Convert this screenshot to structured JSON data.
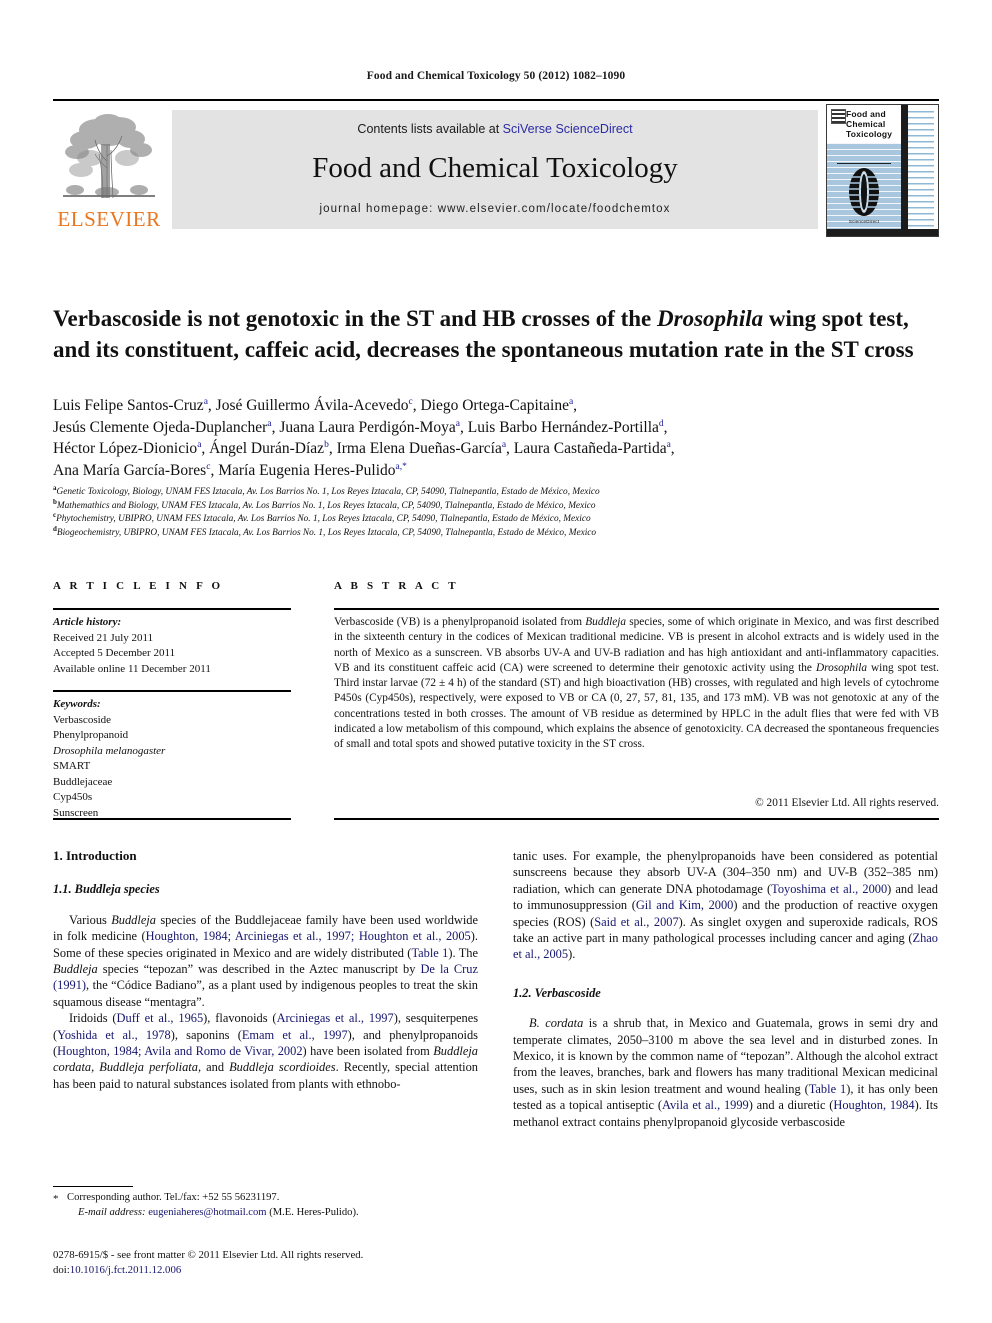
{
  "running_head": "Food and Chemical Toxicology 50 (2012) 1082–1090",
  "masthead": {
    "contents_prefix": "Contents lists available at ",
    "contents_link": "SciVerse ScienceDirect",
    "journal_title": "Food and Chemical Toxicology",
    "homepage": "journal homepage: www.elsevier.com/locate/foodchemtox",
    "publisher_wordmark": "ELSEVIER",
    "publisher_logo_color": "#E87722",
    "link_color": "#2B2BA6"
  },
  "cover": {
    "title_line1": "Food and",
    "title_line2": "Chemical",
    "title_line3": "Toxicology",
    "caption": "ScienceDirect",
    "background_color": "#A8C6DE"
  },
  "article": {
    "title_part1": "Verbascoside is not genotoxic in the ST and HB crosses of the ",
    "title_italic": "Drosophila",
    "title_part2": " wing spot test, and its constituent, caffeic acid, decreases the spontaneous mutation rate in the ST cross",
    "authors_line1": "Luis Felipe Santos-Cruz a, José Guillermo Ávila-Acevedo c, Diego Ortega-Capitaine a,",
    "authors_line2": "Jesús Clemente Ojeda-Duplancher a, Juana Laura Perdigón-Moya a, Luis Barbo Hernández-Portilla d,",
    "authors_line3": "Héctor López-Dionicio a, Ángel Durán-Díaz b, Irma Elena Dueñas-García a, Laura Castañeda-Partida a,",
    "authors_line4": "Ana María García-Bores c, María Eugenia Heres-Pulido a,*",
    "affiliations": [
      {
        "mark": "a",
        "text": "Genetic Toxicology, Biology, UNAM FES Iztacala, Av. Los Barrios No. 1, Los Reyes Iztacala, CP, 54090, Tlalnepantla, Estado de México, Mexico"
      },
      {
        "mark": "b",
        "text": "Mathemathics and Biology, UNAM FES Iztacala, Av. Los Barrios No. 1, Los Reyes Iztacala, CP, 54090, Tlalnepantla, Estado de México, Mexico"
      },
      {
        "mark": "c",
        "text": "Phytochemistry, UBIPRO, UNAM FES Iztacala, Av. Los Barrios No. 1, Los Reyes Iztacala, CP, 54090, Tlalnepantla, Estado de México, Mexico"
      },
      {
        "mark": "d",
        "text": "Biogeochemistry, UBIPRO, UNAM FES Iztacala, Av. Los Barrios No. 1, Los Reyes Iztacala, CP, 54090, Tlalnepantla, Estado de México, Mexico"
      }
    ]
  },
  "article_info": {
    "heading": "A R T I C L E    I N F O",
    "history_label": "Article history:",
    "history": [
      "Received 21 July 2011",
      "Accepted 5 December 2011",
      "Available online 11 December 2011"
    ],
    "keywords_label": "Keywords:",
    "keywords": [
      "Verbascoside",
      "Phenylpropanoid",
      "Drosophila melanogaster",
      "SMART",
      "Buddlejaceae",
      "Cyp450s",
      "Sunscreen"
    ],
    "keywords_italic_index": 2
  },
  "abstract": {
    "heading": "A B S T R A C T",
    "text_1": "Verbascoside (VB) is a phenylpropanoid isolated from ",
    "italic_1": "Buddleja",
    "text_2": " species, some of which originate in Mexico, and was first described in the sixteenth century in the codices of Mexican traditional medicine. VB is present in alcohol extracts and is widely used in the north of Mexico as a sunscreen. VB absorbs UV-A and UV-B radiation and has high antioxidant and anti-inflammatory capacities. VB and its constituent caffeic acid (CA) were screened to determine their genotoxic activity using the ",
    "italic_2": "Drosophila",
    "text_3": " wing spot test. Third instar larvae (72 ± 4 h) of the standard (ST) and high bioactivation (HB) crosses, with regulated and high levels of cytochrome P450s (Cyp450s), respectively, were exposed to VB or CA (0, 27, 57, 81, 135, and 173 mM). VB was not genotoxic at any of the concentrations tested in both crosses. The amount of VB residue as determined by HPLC in the adult flies that were fed with VB indicated a low metabolism of this compound, which explains the absence of genotoxicity. CA decreased the spontaneous frequencies of small and total spots and showed putative toxicity in the ST cross.",
    "copyright": "© 2011 Elsevier Ltd. All rights reserved."
  },
  "body": {
    "left": {
      "h1": "1. Introduction",
      "h2": "1.1. Buddleja species",
      "p1_a": "Various ",
      "p1_sp1": "Buddleja",
      "p1_b": " species of the Buddlejaceae family have been used worldwide in folk medicine (",
      "p1_ref1": "Houghton, 1984; Arciniegas et al., 1997; Houghton et al., 2005",
      "p1_c": "). Some of these species originated in Mexico and are widely distributed (",
      "p1_ref2": "Table 1",
      "p1_d": "). The ",
      "p1_sp2": "Buddleja",
      "p1_e": " species “tepozan” was described in the Aztec manuscript by ",
      "p1_ref3": "De la Cruz (1991)",
      "p1_f": ", the “Códice Badiano”, as a plant used by indigenous peoples to treat the skin squamous disease “mentagra”.",
      "p2_a": "Iridoids (",
      "p2_ref1": "Duff et al., 1965",
      "p2_b": "), flavonoids (",
      "p2_ref2": "Arciniegas et al., 1997",
      "p2_c": "), sesquiterpenes (",
      "p2_ref3": "Yoshida et al., 1978",
      "p2_d": "), saponins (",
      "p2_ref4": "Emam et al., 1997",
      "p2_e": "), and phenylpropanoids (",
      "p2_ref5": "Houghton, 1984; Avila and Romo de Vivar, 2002",
      "p2_f": ") have been isolated from ",
      "p2_sp1": "Buddleja cordata, Buddleja perfoliata,",
      "p2_g": " and ",
      "p2_sp2": "Buddleja scordioides",
      "p2_h": ". Recently, special attention has been paid to natural substances isolated from plants with ethnobo-"
    },
    "right": {
      "p1_a": "tanic uses. For example, the phenylpropanoids have been considered as potential sunscreens because they absorb UV-A (304–350 nm) and UV-B (352–385 nm) radiation, which can generate DNA photodamage (",
      "p1_ref1": "Toyoshima et al., 2000",
      "p1_b": ") and lead to immunosuppression (",
      "p1_ref2": "Gil and Kim, 2000",
      "p1_c": ") and the production of reactive oxygen species (ROS) (",
      "p1_ref3": "Said et al., 2007",
      "p1_d": "). As singlet oxygen and superoxide radicals, ROS take an active part in many pathological processes including cancer and aging (",
      "p1_ref4": "Zhao et al., 2005",
      "p1_e": ").",
      "h2": "1.2. Verbascoside",
      "p2_sp1": "B. cordata",
      "p2_a": " is a shrub that, in Mexico and Guatemala, grows in semi dry and temperate climates, 2050–3100 m above the sea level and in disturbed zones. In Mexico, it is known by the common name of “tepozan”. Although the alcohol extract from the leaves, branches, bark and flowers has many traditional Mexican medicinal uses, such as in skin lesion treatment and wound healing (",
      "p2_ref1": "Table 1",
      "p2_b": "), it has only been tested as a topical antiseptic (",
      "p2_ref2": "Avila et al., 1999",
      "p2_c": ") and a diuretic (",
      "p2_ref3": "Houghton, 1984",
      "p2_d": "). Its methanol extract contains phenylpropanoid glycoside verbascoside"
    }
  },
  "footnote": {
    "star": "*",
    "corresponding": "Corresponding author. Tel./fax: +52 55 56231197.",
    "email_label": "E-mail address:",
    "email": "eugeniaheres@hotmail.com",
    "email_suffix": "(M.E. Heres-Pulido)."
  },
  "footer": {
    "issn_line": "0278-6915/$ - see front matter © 2011 Elsevier Ltd. All rights reserved.",
    "doi_label": "doi:",
    "doi": "10.1016/j.fct.2011.12.006"
  }
}
